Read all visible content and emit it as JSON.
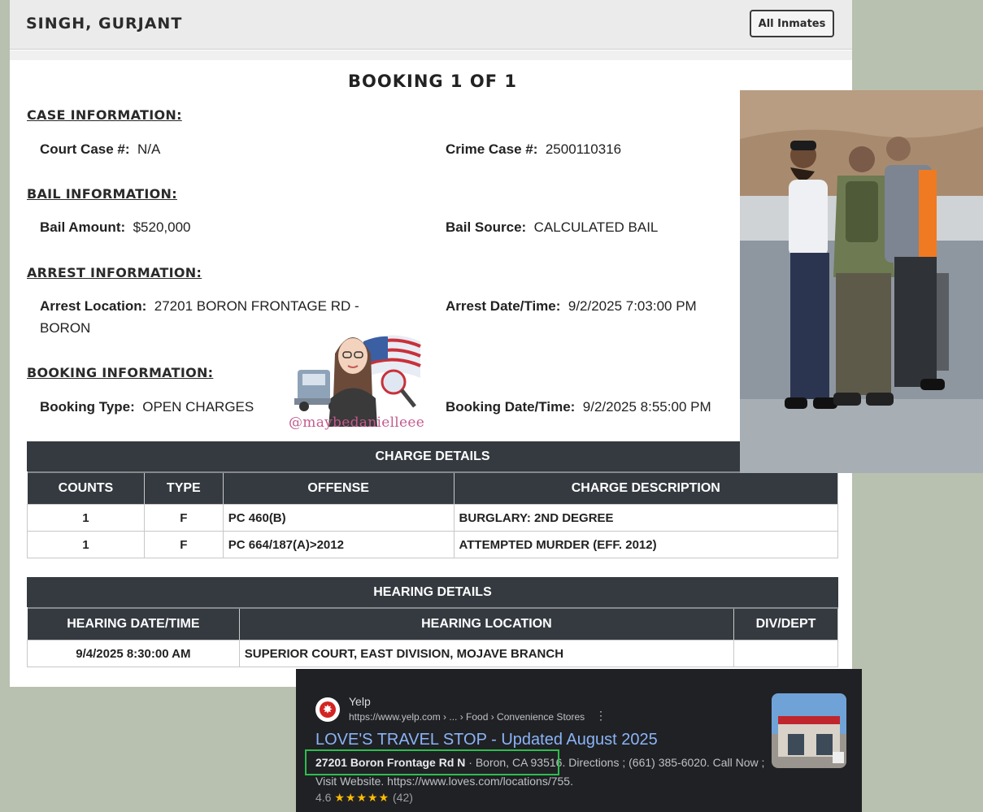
{
  "header": {
    "name": "SINGH, GURJANT",
    "all_inmates_button": "All Inmates"
  },
  "booking_title": "BOOKING 1 OF 1",
  "case": {
    "title": "CASE INFORMATION:",
    "court_case_label": "Court Case #:",
    "court_case_value": "N/A",
    "crime_case_label": "Crime Case #:",
    "crime_case_value": "2500110316"
  },
  "bail": {
    "title": "BAIL INFORMATION:",
    "amount_label": "Bail Amount:",
    "amount_value": "$520,000",
    "source_label": "Bail Source:",
    "source_value": "CALCULATED BAIL"
  },
  "arrest": {
    "title": "ARREST INFORMATION:",
    "location_label": "Arrest Location:",
    "location_value_line1": "27201 BORON FRONTAGE RD -",
    "location_value_line2": "BORON",
    "datetime_label": "Arrest Date/Time:",
    "datetime_value": "9/2/2025 7:03:00 PM"
  },
  "booking": {
    "title": "BOOKING INFORMATION:",
    "type_label": "Booking Type:",
    "type_value": "OPEN CHARGES",
    "datetime_label": "Booking Date/Time:",
    "datetime_value": "9/2/2025 8:55:00 PM"
  },
  "charges": {
    "caption": "CHARGE DETAILS",
    "headers": [
      "COUNTS",
      "TYPE",
      "OFFENSE",
      "CHARGE DESCRIPTION"
    ],
    "rows": [
      [
        "1",
        "F",
        "PC 460(B)",
        "BURGLARY: 2ND DEGREE"
      ],
      [
        "1",
        "F",
        "PC 664/187(A)>2012",
        "ATTEMPTED MURDER (EFF. 2012)"
      ]
    ]
  },
  "hearings": {
    "caption": "HEARING DETAILS",
    "headers": [
      "HEARING DATE/TIME",
      "HEARING LOCATION",
      "DIV/DEPT"
    ],
    "rows": [
      [
        "9/4/2025 8:30:00 AM",
        "SUPERIOR COURT, EAST DIVISION, MOJAVE BRANCH",
        ""
      ]
    ]
  },
  "watermark": {
    "handle": "@maybedanielleee"
  },
  "search_result": {
    "site_name": "Yelp",
    "url": "https://www.yelp.com › ... › Food › Convenience Stores",
    "title": "LOVE'S TRAVEL STOP - Updated August 2025",
    "snippet_bold": "27201 Boron Frontage Rd N",
    "snippet_rest": " · Boron, CA 93516. Directions ; (661) 385-6020. Call Now ; Visit Website. https://www.loves.com/locations/755.",
    "rating": "4.6",
    "stars": "★★★★★",
    "review_count": "(42)"
  },
  "colors": {
    "table_header": "#343a40",
    "highlight_box": "#2dbd4e",
    "link": "#8ab4f8",
    "watermark": "#c25b8e"
  }
}
